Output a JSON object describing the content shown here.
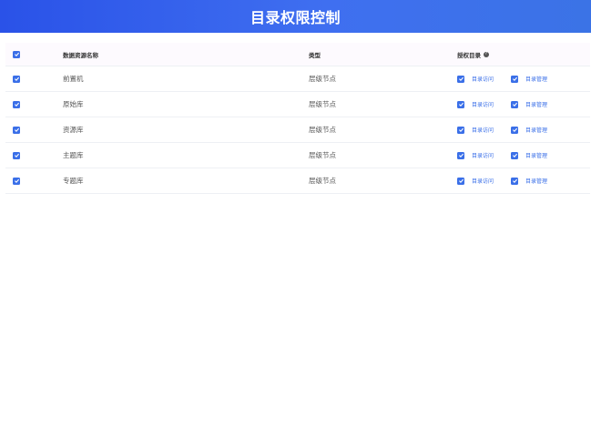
{
  "header": {
    "title": "目录权限控制"
  },
  "table": {
    "columns": {
      "name": "数据资源名称",
      "type": "类型",
      "auth": "授权目录"
    },
    "rows": [
      {
        "name": "前置机",
        "type": "层级节点",
        "perm1": "目录访问",
        "perm2": "目录管理"
      },
      {
        "name": "原始库",
        "type": "层级节点",
        "perm1": "目录访问",
        "perm2": "目录管理"
      },
      {
        "name": "资源库",
        "type": "层级节点",
        "perm1": "目录访问",
        "perm2": "目录管理"
      },
      {
        "name": "主题库",
        "type": "层级节点",
        "perm1": "目录访问",
        "perm2": "目录管理"
      },
      {
        "name": "专题库",
        "type": "层级节点",
        "perm1": "目录访问",
        "perm2": "目录管理"
      }
    ]
  },
  "colors": {
    "accent": "#3a6fe8",
    "header_start": "#2a52e8",
    "header_end": "#3b73e6"
  },
  "icons": {
    "checkbox": "checkbox-checked-icon",
    "help": "question-circle-icon"
  }
}
